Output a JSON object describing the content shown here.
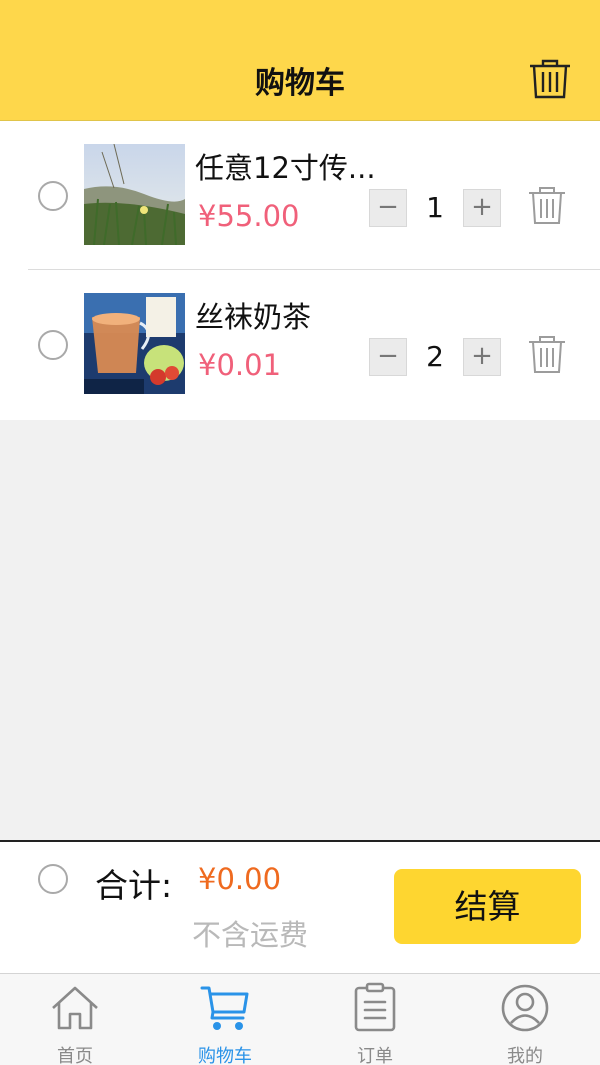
{
  "header": {
    "title": "购物车",
    "trash_icon": "trash-icon"
  },
  "cart": {
    "items": [
      {
        "name": "任意12寸传...",
        "price": "¥55.00",
        "quantity": "1",
        "minus": "−",
        "plus": "+"
      },
      {
        "name": "丝袜奶茶",
        "price": "¥0.01",
        "quantity": "2",
        "minus": "−",
        "plus": "+"
      }
    ]
  },
  "summary": {
    "total_label": "合计:",
    "total_value": "¥0.00",
    "shipping_note": "不含运费",
    "checkout_label": "结算"
  },
  "tabbar": {
    "tabs": [
      {
        "label": "首页",
        "icon": "home-icon"
      },
      {
        "label": "购物车",
        "icon": "cart-icon",
        "active": true
      },
      {
        "label": "订单",
        "icon": "order-list-icon"
      },
      {
        "label": "我的",
        "icon": "profile-icon"
      }
    ]
  },
  "colors": {
    "header_bg": "#fed74b",
    "price": "#f0607a",
    "total": "#ef6a1f",
    "checkout_bg": "#fed630",
    "tab_active": "#2a93e8"
  }
}
